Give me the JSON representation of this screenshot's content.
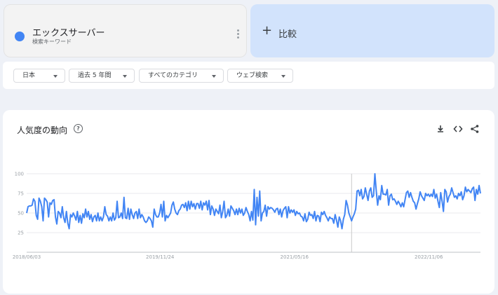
{
  "term": {
    "title": "エックスサーバー",
    "subtitle": "検索キーワード",
    "color": "#4285f4"
  },
  "compare": {
    "label": "比較",
    "plus": "+"
  },
  "filters": [
    {
      "label": "日本"
    },
    {
      "label": "過去 5 年間"
    },
    {
      "label": "すべてのカテゴリ"
    },
    {
      "label": "ウェブ検索"
    }
  ],
  "chart_section": {
    "title": "人気度の動向",
    "help": "?"
  },
  "chart_data": {
    "type": "line",
    "title": "人気度の動向",
    "xlabel": "",
    "ylabel": "",
    "ylim": [
      0,
      100
    ],
    "yticks": [
      25,
      50,
      75,
      100
    ],
    "xtick_labels": [
      "2018/06/03",
      "2019/11/24",
      "2021/05/16",
      "2022/11/06"
    ],
    "grid": true,
    "series": [
      {
        "color": "#4285f4",
        "values": [
          50,
          58,
          59,
          59,
          60,
          68,
          65,
          47,
          42,
          69,
          65,
          58,
          40,
          69,
          67,
          64,
          45,
          63,
          61,
          66,
          67,
          45,
          36,
          52,
          50,
          44,
          58,
          44,
          38,
          52,
          37,
          30,
          48,
          45,
          50,
          46,
          41,
          52,
          38,
          47,
          37,
          49,
          44,
          55,
          45,
          52,
          42,
          48,
          39,
          45,
          47,
          40,
          50,
          40,
          45,
          40,
          45,
          58,
          48,
          46,
          40,
          45,
          40,
          50,
          41,
          44,
          65,
          44,
          45,
          50,
          43,
          70,
          44,
          43,
          56,
          42,
          55,
          48,
          43,
          50,
          52,
          43,
          55,
          44,
          48,
          45,
          40,
          38,
          40,
          45,
          43,
          40,
          32,
          55,
          48,
          45,
          45,
          50,
          61,
          45,
          65,
          40,
          47,
          44,
          47,
          50,
          60,
          64,
          55,
          50,
          48,
          53,
          55,
          60,
          61,
          57,
          63,
          53,
          65,
          55,
          65,
          58,
          62,
          55,
          62,
          62,
          56,
          65,
          54,
          63,
          60,
          65,
          54,
          66,
          48,
          59,
          55,
          47,
          55,
          52,
          49,
          60,
          44,
          52,
          65,
          44,
          47,
          55,
          46,
          59,
          56,
          53,
          48,
          55,
          48,
          56,
          50,
          55,
          47,
          50,
          57,
          52,
          48,
          40,
          52,
          41,
          80,
          35,
          70,
          46,
          78,
          40,
          50,
          52,
          60,
          46,
          58,
          55,
          57,
          56,
          54,
          51,
          55,
          56,
          48,
          55,
          45,
          53,
          56,
          58,
          44,
          58,
          50,
          54,
          51,
          54,
          47,
          52,
          49,
          50,
          46,
          45,
          40,
          49,
          39,
          42,
          51,
          47,
          48,
          43,
          52,
          40,
          47,
          46,
          39,
          51,
          48,
          52,
          47,
          44,
          40,
          45,
          43,
          43,
          37,
          48,
          41,
          32,
          45,
          40,
          30,
          42,
          48,
          66,
          60,
          50,
          45,
          40,
          45,
          49,
          55,
          78,
          79,
          72,
          80,
          68,
          71,
          82,
          74,
          66,
          78,
          82,
          70,
          72,
          100,
          78,
          60,
          72,
          67,
          85,
          74,
          74,
          73,
          80,
          60,
          72,
          74,
          67,
          68,
          65,
          61,
          65,
          62,
          58,
          63,
          58,
          67,
          76,
          78,
          70,
          76,
          70,
          65,
          63,
          55,
          62,
          68,
          77,
          72,
          69,
          66,
          75,
          72,
          74,
          71,
          74,
          71,
          80,
          69,
          74,
          65,
          57,
          76,
          65,
          52,
          80,
          77,
          64,
          71,
          74,
          82,
          76,
          70,
          72,
          68,
          75,
          72,
          77,
          67,
          72,
          83,
          77,
          80,
          78,
          76,
          81,
          83,
          66,
          80,
          74,
          85,
          75
        ]
      }
    ],
    "vline_fraction": 0.716
  },
  "icons": {
    "download": "download-icon",
    "embed": "embed-code-icon",
    "share": "share-icon",
    "help": "help-icon",
    "more": "more-vert-icon"
  }
}
